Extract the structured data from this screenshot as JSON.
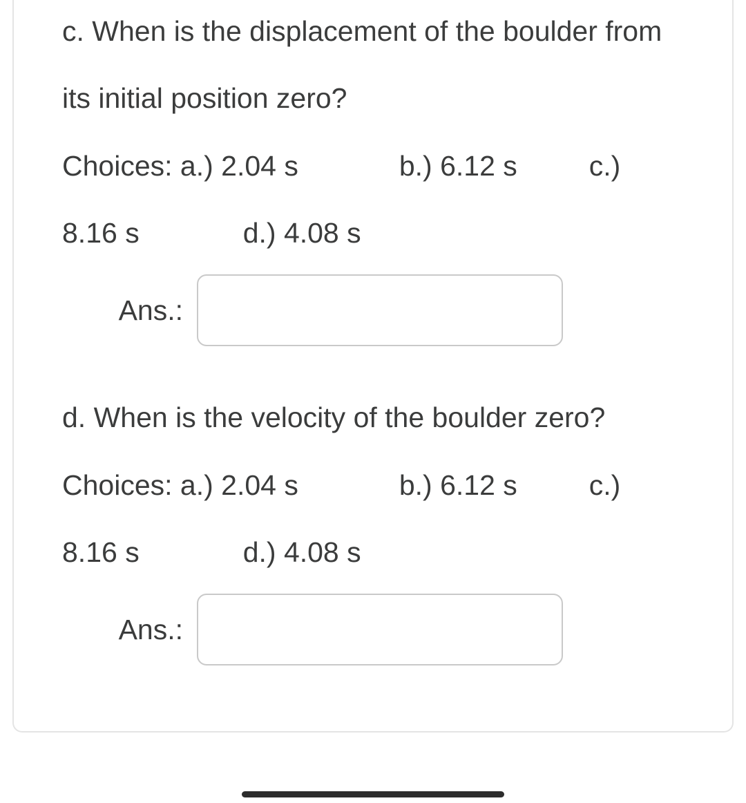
{
  "questions": [
    {
      "id": "c",
      "prompt_line1": "c. When is the displacement of the boulder from",
      "prompt_line2": "its initial position zero?",
      "choices_line1_a": "Choices: a.) 2.04 s",
      "choices_line1_b": "b.) 6.12 s",
      "choices_line1_c": "c.)",
      "choices_line2_a": "8.16 s",
      "choices_line2_d": "d.) 4.08 s",
      "answer_label": "Ans.:",
      "answer_value": ""
    },
    {
      "id": "d",
      "prompt_line1": "d. When is the velocity of the boulder zero?",
      "choices_line1_a": "Choices: a.) 2.04 s",
      "choices_line1_b": "b.) 6.12 s",
      "choices_line1_c": "c.)",
      "choices_line2_a": "8.16 s",
      "choices_line2_d": "d.) 4.08 s",
      "answer_label": "Ans.:",
      "answer_value": ""
    }
  ]
}
